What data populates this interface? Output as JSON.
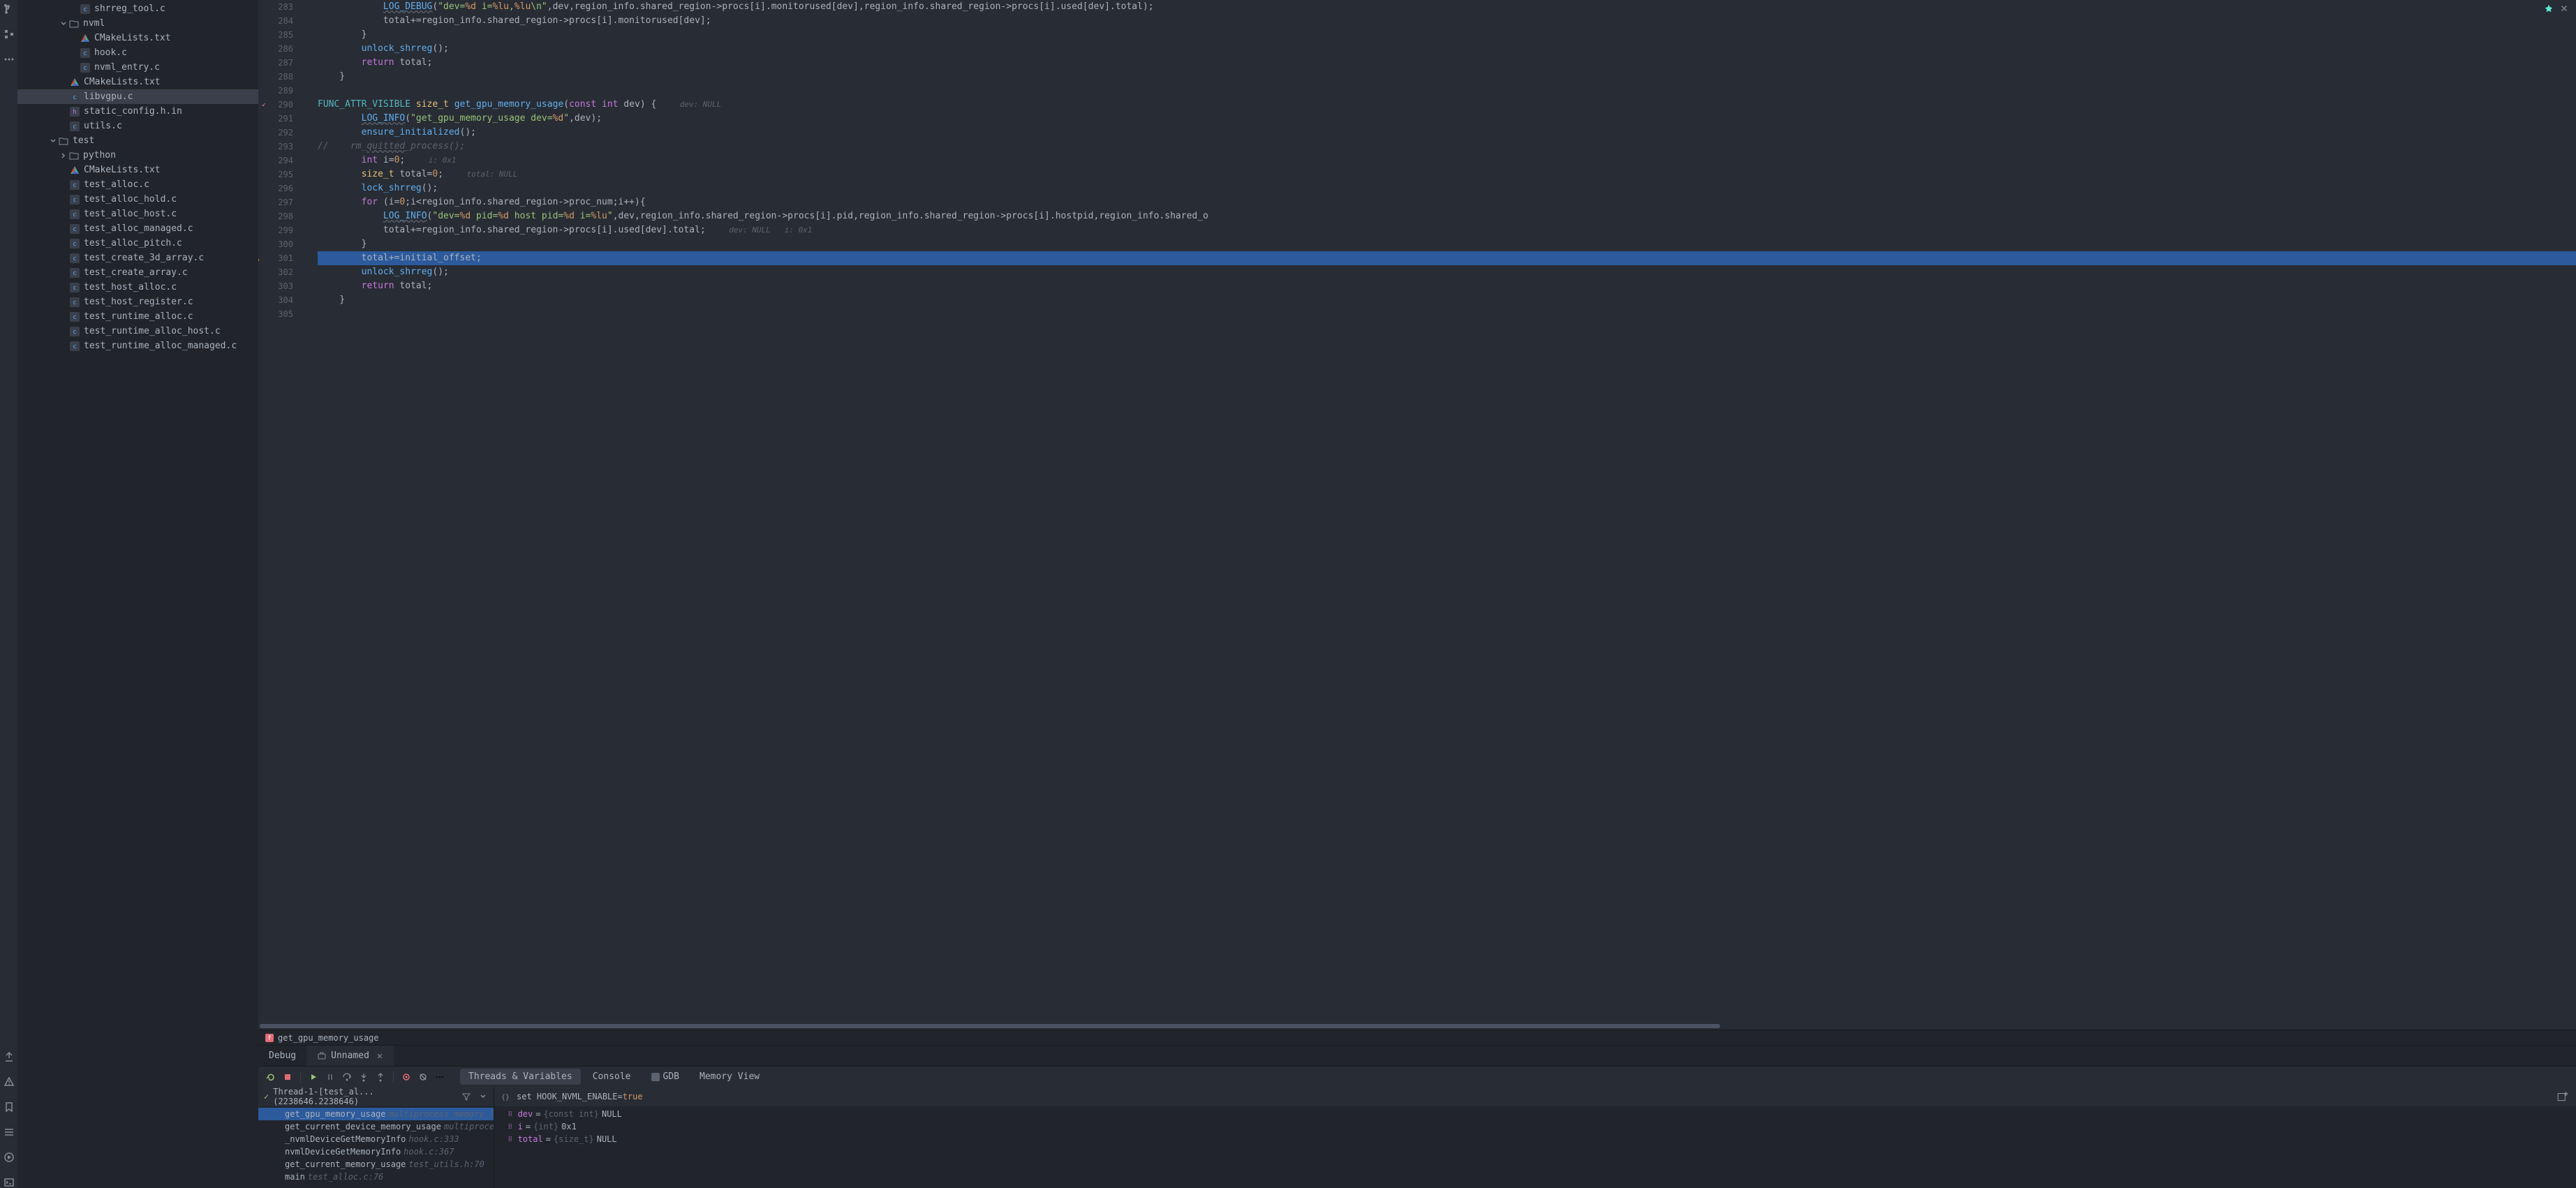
{
  "left_rail": {
    "icons": [
      "branch-icon",
      "structure-icon",
      "more-icon",
      "pull-icon",
      "warning-icon",
      "bookmark-icon",
      "list-icon",
      "run-icon",
      "terminal-icon"
    ]
  },
  "sidebar": {
    "items": [
      {
        "indent": 90,
        "icon": "c",
        "label": "shrreg_tool.c"
      },
      {
        "indent": 60,
        "icon": "folder",
        "label": "nvml",
        "expanded": true,
        "chevron": true
      },
      {
        "indent": 90,
        "icon": "cmake",
        "label": "CMakeLists.txt"
      },
      {
        "indent": 90,
        "icon": "c",
        "label": "hook.c"
      },
      {
        "indent": 90,
        "icon": "c",
        "label": "nvml_entry.c"
      },
      {
        "indent": 75,
        "icon": "cmake",
        "label": "CMakeLists.txt"
      },
      {
        "indent": 75,
        "icon": "c",
        "label": "libvgpu.c",
        "selected": true
      },
      {
        "indent": 75,
        "icon": "h",
        "label": "static_config.h.in"
      },
      {
        "indent": 75,
        "icon": "c",
        "label": "utils.c"
      },
      {
        "indent": 45,
        "icon": "folder",
        "label": "test",
        "expanded": true,
        "chevron": true
      },
      {
        "indent": 60,
        "icon": "folder",
        "label": "python",
        "expanded": false,
        "chevron": true
      },
      {
        "indent": 75,
        "icon": "cmake",
        "label": "CMakeLists.txt"
      },
      {
        "indent": 75,
        "icon": "c",
        "label": "test_alloc.c"
      },
      {
        "indent": 75,
        "icon": "c",
        "label": "test_alloc_hold.c"
      },
      {
        "indent": 75,
        "icon": "c",
        "label": "test_alloc_host.c"
      },
      {
        "indent": 75,
        "icon": "c",
        "label": "test_alloc_managed.c"
      },
      {
        "indent": 75,
        "icon": "c",
        "label": "test_alloc_pitch.c"
      },
      {
        "indent": 75,
        "icon": "c",
        "label": "test_create_3d_array.c"
      },
      {
        "indent": 75,
        "icon": "c",
        "label": "test_create_array.c"
      },
      {
        "indent": 75,
        "icon": "c",
        "label": "test_host_alloc.c"
      },
      {
        "indent": 75,
        "icon": "c",
        "label": "test_host_register.c"
      },
      {
        "indent": 75,
        "icon": "c",
        "label": "test_runtime_alloc.c"
      },
      {
        "indent": 75,
        "icon": "c",
        "label": "test_runtime_alloc_host.c"
      },
      {
        "indent": 75,
        "icon": "c",
        "label": "test_runtime_alloc_managed.c"
      }
    ]
  },
  "editor": {
    "lines": [
      {
        "n": 283,
        "seg": [
          [
            "            ",
            ""
          ],
          [
            "LOG_DEBUG",
            "func squiggle"
          ],
          [
            "(",
            ""
          ],
          [
            "\"dev=",
            "string"
          ],
          [
            "%d",
            "format"
          ],
          [
            " i=",
            "string"
          ],
          [
            "%lu",
            "format"
          ],
          [
            ",",
            "string"
          ],
          [
            "%lu",
            "format"
          ],
          [
            "\\n\"",
            "string"
          ],
          [
            ",dev,region_info.",
            "op"
          ],
          [
            "shared_region",
            "member"
          ],
          [
            "->",
            "op"
          ],
          [
            "procs",
            "member"
          ],
          [
            "[i].",
            "op"
          ],
          [
            "monitorused",
            "member"
          ],
          [
            "[dev],region_info.",
            "op"
          ],
          [
            "shared_region",
            "member"
          ],
          [
            "->",
            "op"
          ],
          [
            "procs",
            "member"
          ],
          [
            "[i].",
            "op"
          ],
          [
            "used",
            "member"
          ],
          [
            "[dev].",
            "op"
          ],
          [
            "total",
            "member"
          ],
          [
            ");",
            "op"
          ]
        ]
      },
      {
        "n": 284,
        "seg": [
          [
            "            total+=region_info.",
            "op"
          ],
          [
            "shared_region",
            "member"
          ],
          [
            "->",
            "op"
          ],
          [
            "procs",
            "member"
          ],
          [
            "[i].",
            "op"
          ],
          [
            "monitorused",
            "member"
          ],
          [
            "[dev];",
            "op"
          ]
        ]
      },
      {
        "n": 285,
        "seg": [
          [
            "        }",
            ""
          ]
        ]
      },
      {
        "n": 286,
        "seg": [
          [
            "        ",
            ""
          ],
          [
            "unlock_shrreg",
            "func"
          ],
          [
            "();",
            ""
          ]
        ]
      },
      {
        "n": 287,
        "seg": [
          [
            "        ",
            ""
          ],
          [
            "return",
            "keyword"
          ],
          [
            " total;",
            ""
          ]
        ]
      },
      {
        "n": 288,
        "seg": [
          [
            "    }",
            ""
          ]
        ]
      },
      {
        "n": 289,
        "seg": [
          [
            "",
            ""
          ]
        ]
      },
      {
        "n": 290,
        "seg": [
          [
            "",
            ""
          ],
          [
            "FUNC_ATTR_VISIBLE",
            "macro"
          ],
          [
            " ",
            ""
          ],
          [
            "size_t",
            "type"
          ],
          [
            " ",
            ""
          ],
          [
            "get_gpu_memory_usage",
            "func"
          ],
          [
            "(",
            ""
          ],
          [
            "const",
            "keyword"
          ],
          [
            " ",
            ""
          ],
          [
            "int",
            "keyword"
          ],
          [
            " dev) {   ",
            ""
          ],
          [
            "dev: NULL",
            "inlay"
          ]
        ],
        "marker": "fn"
      },
      {
        "n": 291,
        "seg": [
          [
            "        ",
            ""
          ],
          [
            "LOG_INFO",
            "func squiggle"
          ],
          [
            "(",
            ""
          ],
          [
            "\"get_gpu_memory_usage dev=",
            "string"
          ],
          [
            "%d",
            "format"
          ],
          [
            "\"",
            "string"
          ],
          [
            ",dev);",
            ""
          ]
        ]
      },
      {
        "n": 292,
        "seg": [
          [
            "        ",
            ""
          ],
          [
            "ensure_initialized",
            "func"
          ],
          [
            "();",
            ""
          ]
        ]
      },
      {
        "n": 293,
        "seg": [
          [
            "//    rm_",
            "comment"
          ],
          [
            "quitted",
            "comment squiggle"
          ],
          [
            "_process();",
            "comment"
          ]
        ]
      },
      {
        "n": 294,
        "seg": [
          [
            "        ",
            ""
          ],
          [
            "int",
            "keyword"
          ],
          [
            " i=",
            ""
          ],
          [
            "0",
            "number"
          ],
          [
            ";   ",
            ""
          ],
          [
            "i: 0x1",
            "inlay"
          ]
        ]
      },
      {
        "n": 295,
        "seg": [
          [
            "        ",
            ""
          ],
          [
            "size_t",
            "type"
          ],
          [
            " total=",
            ""
          ],
          [
            "0",
            "number"
          ],
          [
            ";   ",
            ""
          ],
          [
            "total: NULL",
            "inlay"
          ]
        ]
      },
      {
        "n": 296,
        "seg": [
          [
            "        ",
            ""
          ],
          [
            "lock_shrreg",
            "func"
          ],
          [
            "();",
            ""
          ]
        ]
      },
      {
        "n": 297,
        "seg": [
          [
            "        ",
            ""
          ],
          [
            "for",
            "keyword"
          ],
          [
            " (i=",
            ""
          ],
          [
            "0",
            "number"
          ],
          [
            ";i<region_info.",
            "op"
          ],
          [
            "shared_region",
            "member"
          ],
          [
            "->",
            "op"
          ],
          [
            "proc_num",
            "member"
          ],
          [
            ";i++){",
            ""
          ]
        ]
      },
      {
        "n": 298,
        "seg": [
          [
            "            ",
            ""
          ],
          [
            "LOG_INFO",
            "func squiggle"
          ],
          [
            "(",
            ""
          ],
          [
            "\"dev=",
            "string"
          ],
          [
            "%d",
            "format"
          ],
          [
            " pid=",
            "string"
          ],
          [
            "%d",
            "format"
          ],
          [
            " host pid=",
            "string"
          ],
          [
            "%d",
            "format"
          ],
          [
            " i=",
            "string"
          ],
          [
            "%lu",
            "format"
          ],
          [
            "\"",
            "string"
          ],
          [
            ",dev,region_info.",
            "op"
          ],
          [
            "shared_region",
            "member"
          ],
          [
            "->",
            "op"
          ],
          [
            "procs",
            "member"
          ],
          [
            "[i].",
            "op"
          ],
          [
            "pid",
            "member"
          ],
          [
            ",region_info.",
            "op"
          ],
          [
            "shared_region",
            "member"
          ],
          [
            "->",
            "op"
          ],
          [
            "procs",
            "member"
          ],
          [
            "[i].",
            "op"
          ],
          [
            "hostpid",
            "member"
          ],
          [
            ",region_info.",
            "op"
          ],
          [
            "shared_o",
            "member"
          ]
        ]
      },
      {
        "n": 299,
        "seg": [
          [
            "            total+=region_info.",
            "op"
          ],
          [
            "shared_region",
            "member"
          ],
          [
            "->",
            "op"
          ],
          [
            "procs",
            "member"
          ],
          [
            "[i].",
            "op"
          ],
          [
            "used",
            "member"
          ],
          [
            "[dev].",
            "op"
          ],
          [
            "total",
            "member"
          ],
          [
            ";   ",
            ""
          ],
          [
            "dev: NULL   i: 0x1",
            "inlay"
          ]
        ]
      },
      {
        "n": 300,
        "seg": [
          [
            "        }",
            ""
          ]
        ]
      },
      {
        "n": 301,
        "seg": [
          [
            "        total+=initial_offset;",
            ""
          ]
        ],
        "current": true,
        "bp": true
      },
      {
        "n": 302,
        "seg": [
          [
            "        ",
            ""
          ],
          [
            "unlock_shrreg",
            "func"
          ],
          [
            "();",
            ""
          ]
        ]
      },
      {
        "n": 303,
        "seg": [
          [
            "        ",
            ""
          ],
          [
            "return",
            "keyword"
          ],
          [
            " total;",
            ""
          ]
        ]
      },
      {
        "n": 304,
        "seg": [
          [
            "    }",
            ""
          ]
        ]
      },
      {
        "n": 305,
        "seg": [
          [
            "",
            ""
          ]
        ]
      }
    ]
  },
  "breadcrumb": {
    "fn": "get_gpu_memory_usage"
  },
  "panel_tabs": {
    "debug": "Debug",
    "unnamed": "Unnamed"
  },
  "debug_subtabs": {
    "threads": "Threads & Variables",
    "console": "Console",
    "gdb": "GDB",
    "memory": "Memory View"
  },
  "thread": {
    "label": "Thread-1-[test_al...(2238646.2238646)"
  },
  "stack": [
    {
      "fn": "get_gpu_memory_usage",
      "loc": "multiprocess_memory_limit.",
      "selected": true
    },
    {
      "fn": "get_current_device_memory_usage",
      "loc": "multiprocess_m"
    },
    {
      "fn": "_nvmlDeviceGetMemoryInfo",
      "loc": "hook.c:333"
    },
    {
      "fn": "nvmlDeviceGetMemoryInfo",
      "loc": "hook.c:367"
    },
    {
      "fn": "get_current_memory_usage",
      "loc": "test_utils.h:70"
    },
    {
      "fn": "main",
      "loc": "test_alloc.c:76"
    }
  ],
  "expr": {
    "prefix": "set HOOK_NVML_ENABLE=",
    "value": "true"
  },
  "vars": [
    {
      "name": "dev",
      "type": "{const int}",
      "val": "NULL"
    },
    {
      "name": "i",
      "type": "{int}",
      "val": "0x1"
    },
    {
      "name": "total",
      "type": "{size_t}",
      "val": "NULL"
    }
  ]
}
